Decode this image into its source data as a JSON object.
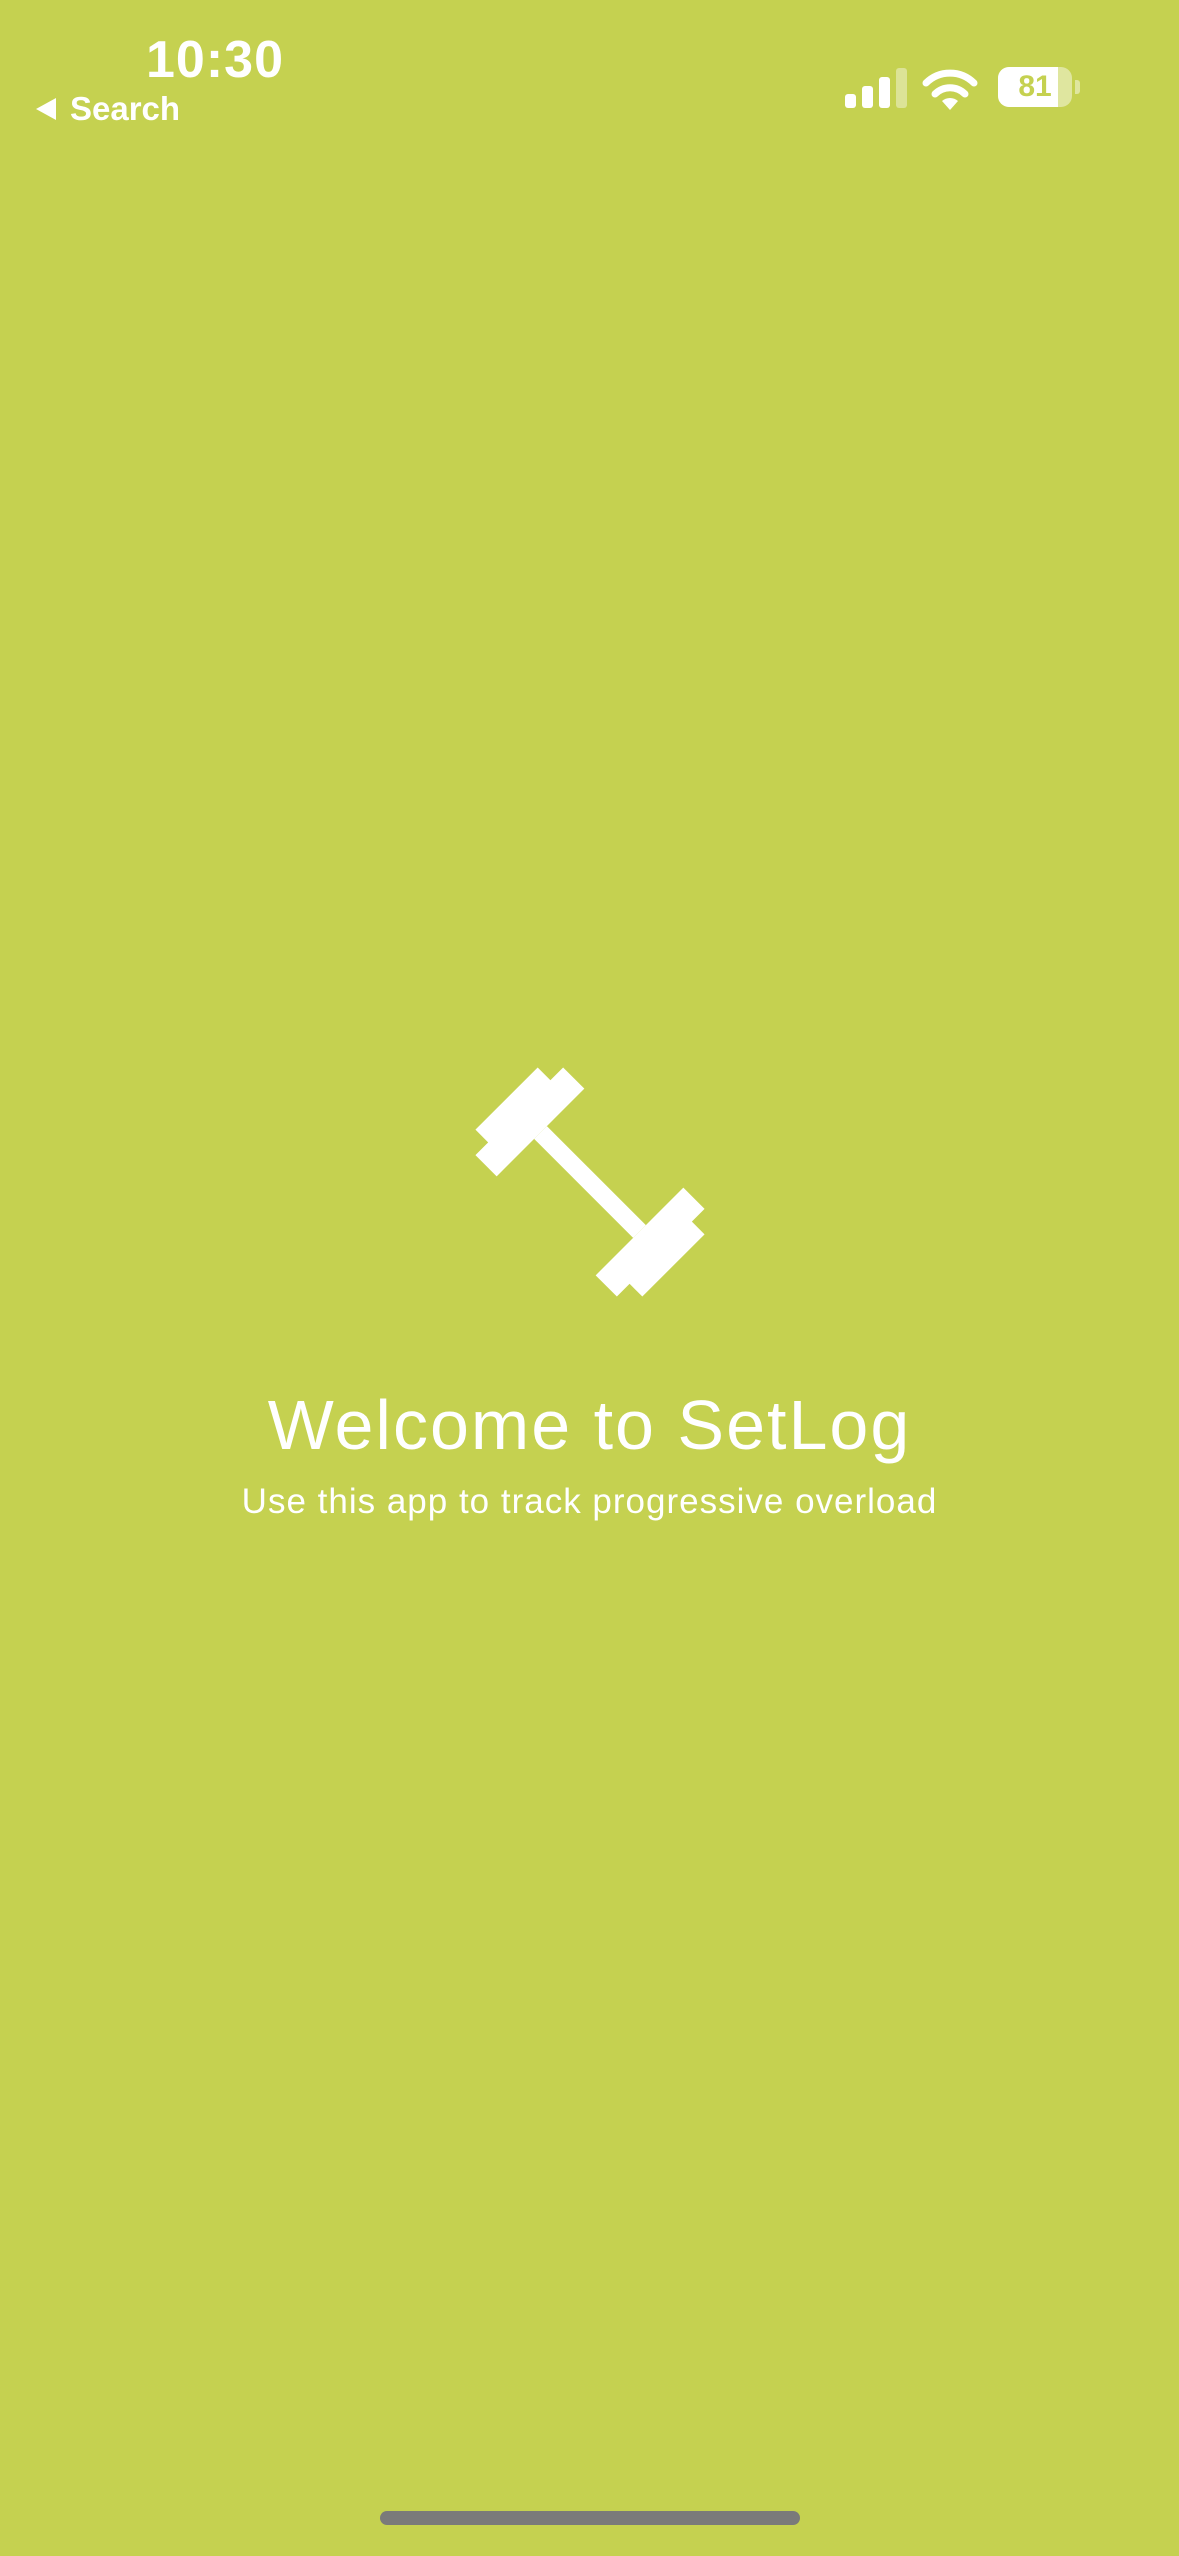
{
  "status_bar": {
    "time": "10:30",
    "back_label": "Search",
    "battery_level": "81",
    "battery_fraction": 0.81,
    "signal_bars_active": 3,
    "signal_bars_total": 4
  },
  "welcome": {
    "icon": "dumbbell-icon",
    "title": "Welcome to SetLog",
    "subtitle": "Use this app to track progressive overload"
  },
  "colors": {
    "background": "#C5D150",
    "foreground": "#FFFFFF",
    "home_indicator": "#7A7A7A"
  }
}
